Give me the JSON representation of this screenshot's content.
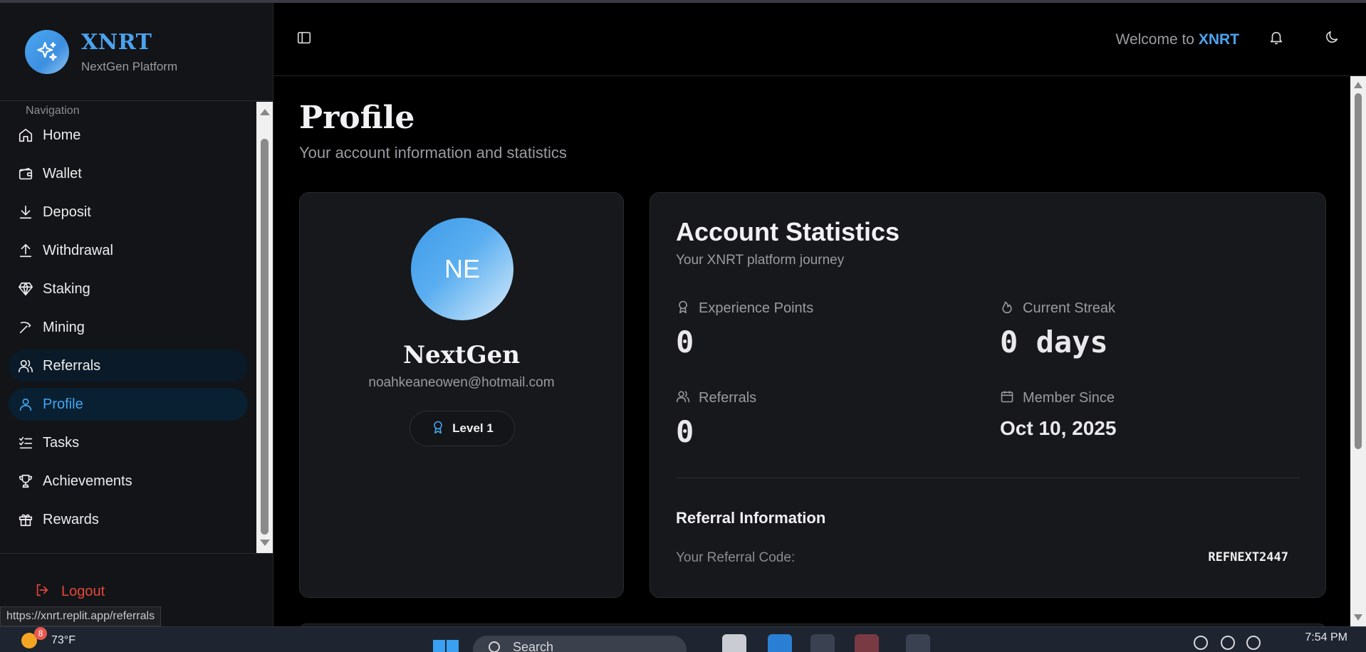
{
  "brand": {
    "title": "XNRT",
    "subtitle": "NextGen Platform"
  },
  "sidebar": {
    "heading": "Navigation",
    "items": [
      {
        "label": "Home",
        "icon": "home-icon"
      },
      {
        "label": "Wallet",
        "icon": "wallet-icon"
      },
      {
        "label": "Deposit",
        "icon": "download-icon"
      },
      {
        "label": "Withdrawal",
        "icon": "upload-icon"
      },
      {
        "label": "Staking",
        "icon": "gem-icon"
      },
      {
        "label": "Mining",
        "icon": "pickaxe-icon"
      },
      {
        "label": "Referrals",
        "icon": "users-icon"
      },
      {
        "label": "Profile",
        "icon": "user-icon"
      },
      {
        "label": "Tasks",
        "icon": "list-checks-icon"
      },
      {
        "label": "Achievements",
        "icon": "trophy-icon"
      },
      {
        "label": "Rewards",
        "icon": "gift-icon"
      }
    ],
    "active": "Profile",
    "hovered": "Referrals",
    "logout_label": "Logout"
  },
  "status_url": "https://xnrt.replit.app/referrals",
  "header": {
    "welcome_prefix": "Welcome to ",
    "welcome_brand": "XNRT"
  },
  "page": {
    "title": "Profile",
    "subtitle": "Your account information and statistics"
  },
  "profile": {
    "initials": "NE",
    "name": "NextGen",
    "email": "noahkeaneowen@hotmail.com",
    "level": "Level 1"
  },
  "stats": {
    "title": "Account Statistics",
    "subtitle": "Your XNRT platform journey",
    "experience_label": "Experience Points",
    "experience_value": "0",
    "streak_label": "Current Streak",
    "streak_value": "0 days",
    "referrals_label": "Referrals",
    "referrals_value": "0",
    "member_since_label": "Member Since",
    "member_since_value": "Oct 10, 2025"
  },
  "referral": {
    "title": "Referral Information",
    "code_label": "Your Referral Code:",
    "code": "REFNEXT2447"
  },
  "taskbar": {
    "temperature": "73°F",
    "weather_badge": "8",
    "search_label": "Search",
    "time": "7:54 PM"
  },
  "colors": {
    "accent": "#4ba3ee",
    "danger": "#e5473c",
    "card_bg": "#17181b",
    "sidebar_bg": "#131417"
  }
}
